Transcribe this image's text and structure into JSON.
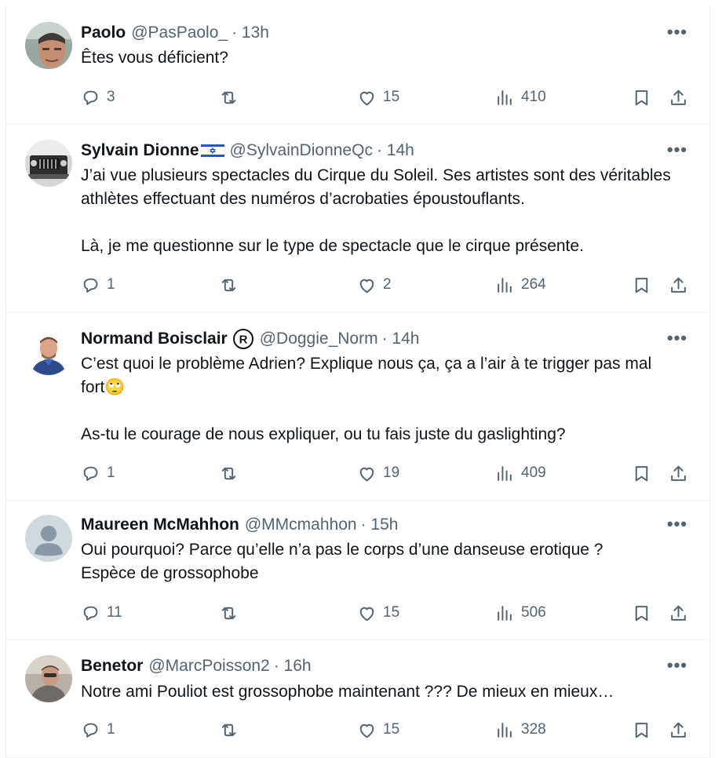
{
  "tweets": [
    {
      "name": "Paolo",
      "handle": "@PasPaolo_",
      "time": "· 13h",
      "text": "Êtes vous déficient?",
      "replies": "3",
      "likes": "15",
      "views": "410"
    },
    {
      "name": "Sylvain Dionne",
      "handle": "@SylvainDionneQc",
      "time": "· 14h",
      "text": "J’ai vue plusieurs spectacles du Cirque du Soleil. Ses artistes sont des véritables athlètes effectuant des numéros d’acrobaties époustouflants.\n\nLà, je me questionne sur le type de spectacle que le cirque présente.",
      "replies": "1",
      "likes": "2",
      "views": "264"
    },
    {
      "name": "Normand Boisclair",
      "handle": "@Doggie_Norm",
      "time": "· 14h",
      "text": "C’est quoi le problème Adrien? Explique nous ça, ça a l’air à te trigger pas mal fort🙄\n\nAs-tu le courage de nous expliquer, ou tu fais juste du gaslighting?",
      "replies": "1",
      "likes": "19",
      "views": "409"
    },
    {
      "name": "Maureen McMahhon",
      "handle": "@MMcmahhon",
      "time": "· 15h",
      "text": "Oui pourquoi? Parce qu’elle n’a pas le corps d’une danseuse erotique ?\nEspèce de grossophobe",
      "replies": "11",
      "likes": "15",
      "views": "506"
    },
    {
      "name": "Benetor",
      "handle": "@MarcPoisson2",
      "time": "· 16h",
      "text": "Notre ami Pouliot est grossophobe maintenant ??? De mieux en mieux…",
      "replies": "1",
      "likes": "15",
      "views": "328"
    }
  ],
  "icons": {
    "more": "more-icon",
    "reply": "reply-icon",
    "retweet": "retweet-icon",
    "like": "heart-icon",
    "views": "views-icon",
    "bookmark": "bookmark-icon",
    "share": "share-icon"
  },
  "colors": {
    "text": "#0f1419",
    "muted": "#536471",
    "divider": "#eff3f4"
  }
}
